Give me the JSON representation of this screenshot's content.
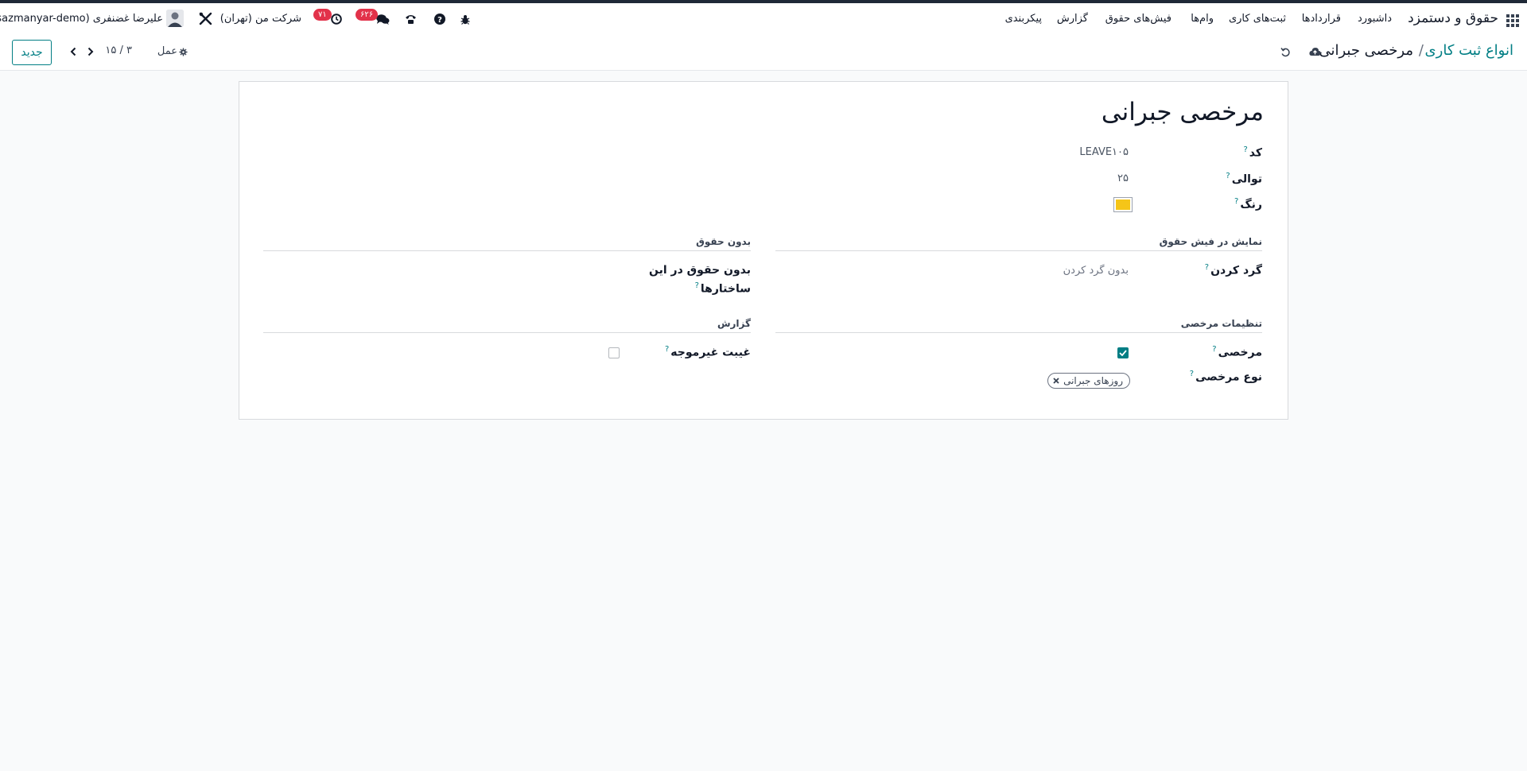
{
  "navbar": {
    "brand": "حقوق و دستمزد",
    "menu": [
      "داشبورد",
      "قراردادها",
      "ثبت‌های کاری",
      "وام‌ها",
      "فیش‌های حقوق",
      "گزارش",
      "پیکربندی"
    ],
    "messages_count": "۶۲۶",
    "activities_count": "۷۱",
    "company": "شرکت من (تهران)",
    "user": "علیرضا غضنفری (sazmanyar-demo)"
  },
  "controlbar": {
    "breadcrumb_parent": "انواع ثبت کاری",
    "breadcrumb_separator": "/",
    "breadcrumb_current": "مرخصی جبرانی",
    "actions_label": "عمل",
    "pager": "۳ / ۱۵",
    "new_button": "جدید"
  },
  "form": {
    "title": "مرخصی جبرانی",
    "code_label": "کد",
    "code_value": "LEAVE۱۰۵",
    "sequence_label": "توالی",
    "sequence_value": "۲۵",
    "color_label": "رنگ",
    "color_value": "#f5c518",
    "section_payslip": "نمایش در فیش حقوق",
    "rounding_label": "گرد کردن",
    "rounding_value": "بدون گرد کردن",
    "section_unpaid": "بدون حقوق",
    "unpaid_structures_label_line1": "بدون حقوق در این",
    "unpaid_structures_label_line2": "ساختارها",
    "section_leave": "تنظیمات مرخصی",
    "leave_label": "مرخصی",
    "leave_checked": true,
    "leave_type_label": "نوع مرخصی",
    "leave_type_tag": "روزهای جبرانی",
    "section_report": "گزارش",
    "unjustified_label": "غیبت غیرموجه",
    "unjustified_checked": false
  },
  "colors": {
    "accent": "#017e84",
    "badge": "#e2324a",
    "swatch": "#f5c518"
  },
  "icons": {
    "apps": "apps-grid-icon",
    "debug": "bug-icon",
    "help": "question-circle-icon",
    "phone": "phone-icon",
    "messages": "chat-bubbles-icon",
    "activities": "clock-icon",
    "settings": "tools-icon",
    "save": "cloud-upload-icon",
    "discard": "undo-icon",
    "actions": "gear-icon"
  }
}
